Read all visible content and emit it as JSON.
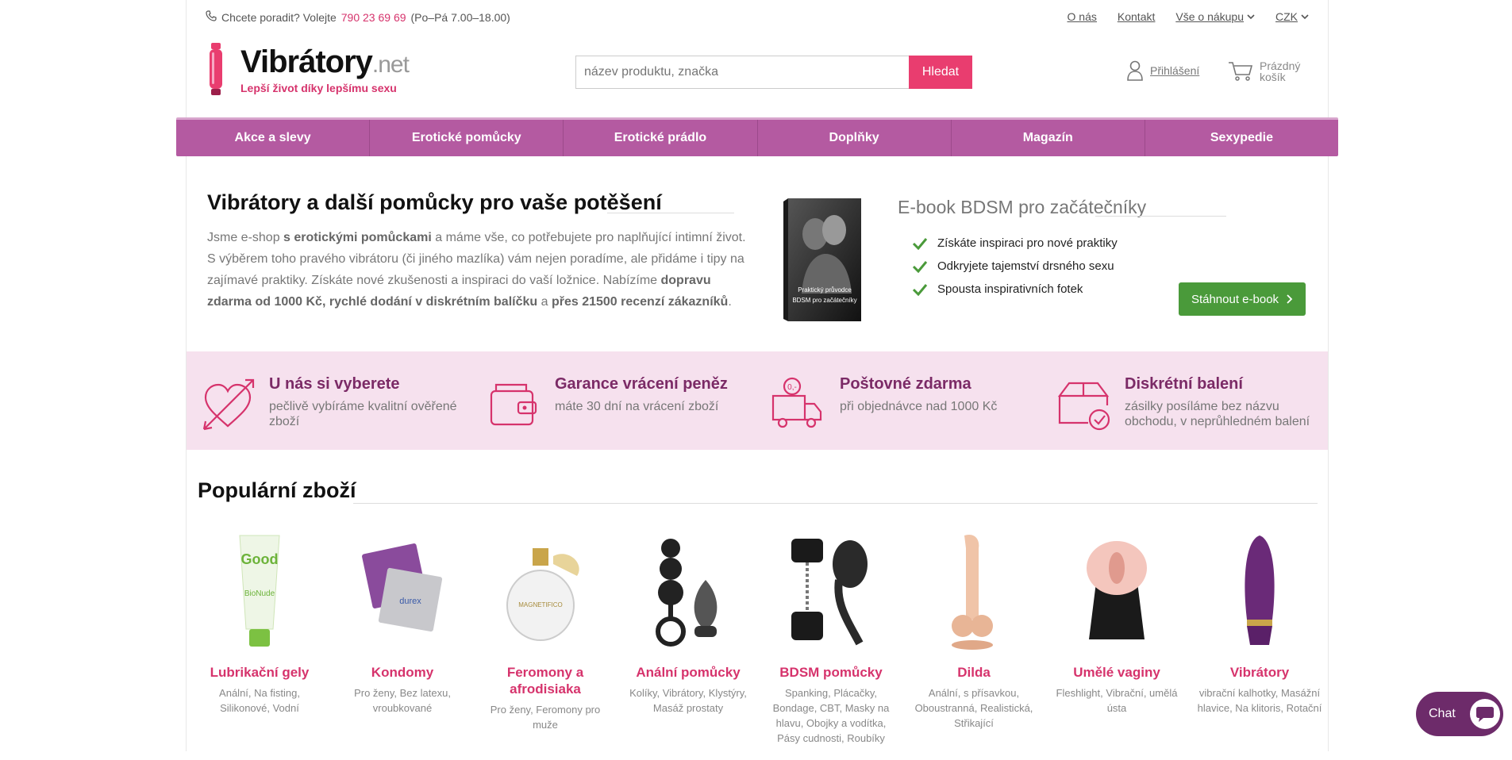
{
  "topbar": {
    "phone_prefix": "Chcete poradit? Volejte",
    "phone_number": "790 23 69 69",
    "phone_hours": "(Po–Pá 7.00–18.00)",
    "links": [
      "O nás",
      "Kontakt",
      "Vše o nákupu",
      "CZK"
    ]
  },
  "logo": {
    "word": "Vibrátory",
    "suffix": ".net",
    "tagline": "Lepší život díky lepšímu sexu"
  },
  "search": {
    "placeholder": "název produktu, značka",
    "button": "Hledat"
  },
  "account": {
    "login": "Přihlášení",
    "cart_line1": "Prázdný",
    "cart_line2": "košík"
  },
  "nav": [
    "Akce a slevy",
    "Erotické pomůcky",
    "Erotické prádlo",
    "Doplňky",
    "Magazín",
    "Sexypedie"
  ],
  "intro": {
    "title": "Vibrátory a další pomůcky pro vaše potěšení",
    "t1": "Jsme e-shop ",
    "b1": "s erotickými pomůckami",
    "t2": " a máme vše, co potřebujete pro naplňující intimní život. S výběrem toho pravého vibrátoru (či jiného mazlíka) vám nejen poradíme, ale přidáme i tipy na zajímavé praktiky. Získáte nové zkušenosti a inspiraci do vaší ložnice. Nabízíme ",
    "b2": "dopravu zdarma od 1000 Kč, rychlé dodání v diskrétním balíčku",
    "t3": " a ",
    "b3": "přes 21500 recenzí zákazníků",
    "t4": "."
  },
  "ebook": {
    "title": "E-book BDSM pro začátečníky",
    "cover_line1": "Praktický průvodce",
    "cover_line2": "BDSM pro začátečníky",
    "items": [
      "Získáte inspiraci pro nové praktiky",
      "Odkryjete tajemství drsného sexu",
      "Spousta inspirativních fotek"
    ],
    "button": "Stáhnout e-book",
    "check_color": "#4a9a3a"
  },
  "features": [
    {
      "title": "U nás si vyberete",
      "desc": "pečlivě vybíráme kvalitní ověřené zboží",
      "icon": "heart-arrow-icon"
    },
    {
      "title": "Garance vrácení peněz",
      "desc": "máte 30 dní na vrácení zboží",
      "icon": "wallet-icon"
    },
    {
      "title": "Poštovné zdarma",
      "desc": "při objednávce nad 1000 Kč",
      "icon": "delivery-truck-icon"
    },
    {
      "title": "Diskrétní balení",
      "desc": "zásilky posíláme bez názvu obchodu, v neprůhledném balení",
      "icon": "package-check-icon"
    }
  ],
  "popular": {
    "title": "Populární zboží",
    "products": [
      {
        "name": "Lubrikační gely",
        "tags": "Anální, Na fisting, Silikonové, Vodní"
      },
      {
        "name": "Kondomy",
        "tags": "Pro ženy, Bez latexu, vroubkované"
      },
      {
        "name": "Feromony a afrodisiaka",
        "tags": "Pro ženy, Feromony pro muže"
      },
      {
        "name": "Anální pomůcky",
        "tags": "Kolíky, Vibrátory, Klystýry, Masáž prostaty"
      },
      {
        "name": "BDSM pomůcky",
        "tags": "Spanking, Plácačky, Bondage, CBT, Masky na hlavu, Obojky a vodítka, Pásy cudnosti, Roubíky"
      },
      {
        "name": "Dilda",
        "tags": "Anální, s přísavkou, Oboustranná, Realistická, Střikající"
      },
      {
        "name": "Umělé vaginy",
        "tags": "Fleshlight, Vibrační, umělá ústa"
      },
      {
        "name": "Vibrátory",
        "tags": "vibrační kalhotky, Masážní hlavice, Na klitoris, Rotační"
      }
    ]
  },
  "chat": {
    "label": "Chat"
  },
  "colors": {
    "accent": "#e93d6f",
    "nav": "#b45aa1",
    "feature_bg": "#f6e1ee",
    "feature_title": "#7b2a66"
  }
}
